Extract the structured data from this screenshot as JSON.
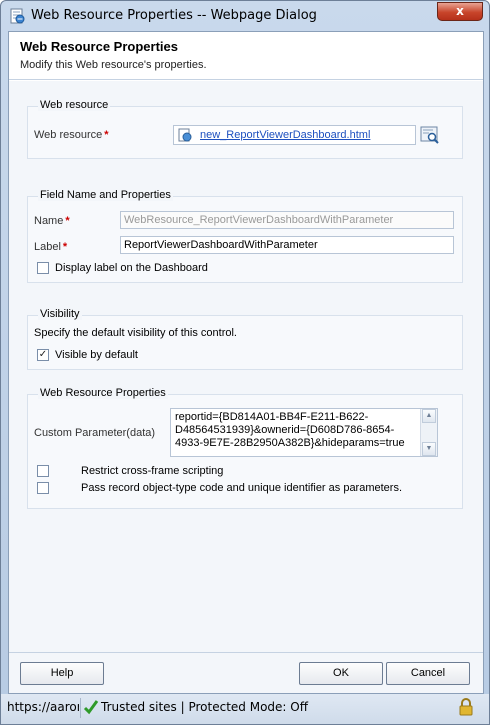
{
  "window": {
    "title": "Web Resource Properties -- Webpage Dialog",
    "close_label": "x"
  },
  "header": {
    "title": "Web Resource Properties",
    "subtitle": "Modify this Web resource's properties."
  },
  "web_resource_section": {
    "legend": "Web resource",
    "field_label": "Web resource",
    "required_marker": "*",
    "value": "new_ReportViewerDashboard.html"
  },
  "field_section": {
    "legend": "Field Name and Properties",
    "name_label": "Name",
    "name_value": "WebResource_ReportViewerDashboardWithParameter",
    "label_label": "Label",
    "label_value": "ReportViewerDashboardWithParameter",
    "required_marker": "*",
    "display_label_checkbox": "Display label on the Dashboard",
    "display_label_checked": false
  },
  "visibility_section": {
    "legend": "Visibility",
    "description": "Specify the default visibility of this control.",
    "visible_checkbox": "Visible by default",
    "visible_checked": true
  },
  "properties_section": {
    "legend": "Web Resource Properties",
    "custom_param_label": "Custom Parameter(data)",
    "custom_param_value": "reportid={BD814A01-BB4F-E211-B622-D48564531939}&ownerid={D608D786-8654-4933-9E7E-28B2950A382B}&hideparams=true",
    "restrict_checkbox": "Restrict cross-frame scripting",
    "restrict_checked": false,
    "pass_record_checkbox": "Pass record object-type code and unique identifier as parameters.",
    "pass_record_checked": false
  },
  "footer": {
    "help_label": "Help",
    "ok_label": "OK",
    "cancel_label": "Cancel"
  },
  "statusbar": {
    "url": "https://aaron",
    "zone": "Trusted sites | Protected Mode: Off"
  },
  "icons": {
    "window_icon": "ie-page-icon",
    "lookup_item": "web-resource-icon",
    "lookup_button": "lookup-search-icon",
    "status_check": "green-check-icon",
    "status_lock": "lock-icon"
  },
  "colors": {
    "link": "#1c4fbf",
    "required": "#cc0000",
    "close_button": "#c8452b"
  }
}
